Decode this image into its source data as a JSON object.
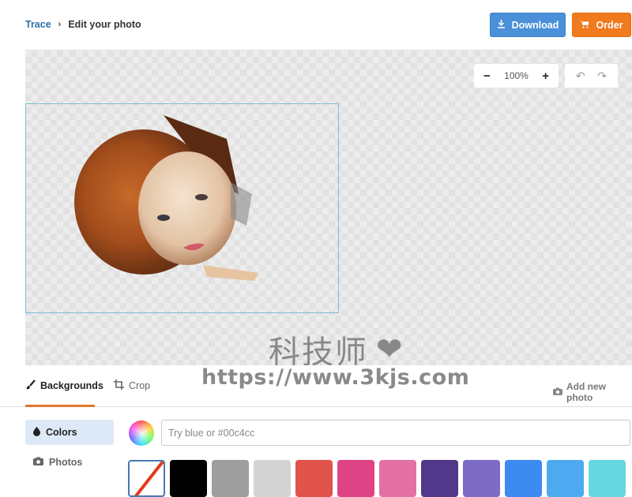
{
  "breadcrumb": {
    "root": "Trace",
    "separator": "›",
    "current": "Edit your photo"
  },
  "header": {
    "download_label": "Download",
    "order_label": "Order",
    "download_icon": "download-icon",
    "order_icon": "cart-icon",
    "colors": {
      "download": "#4a90d9",
      "order": "#f07a1e"
    }
  },
  "canvas": {
    "zoom_out": "−",
    "zoom_level": "100%",
    "zoom_in": "+",
    "undo": "↶",
    "redo": "↷",
    "photo_description": "Pixelated portrait of a person with red-brown hair"
  },
  "watermark": {
    "cn_text": "科技师",
    "heart": "❤",
    "url": "https://www.3kjs.com"
  },
  "tabs": [
    {
      "label": "Backgrounds",
      "icon": "brush-icon",
      "active": true
    },
    {
      "label": "Crop",
      "icon": "crop-icon",
      "active": false
    }
  ],
  "add_photo_label": "Add new photo",
  "sidebar": [
    {
      "label": "Colors",
      "icon": "drop-icon",
      "active": true
    },
    {
      "label": "Photos",
      "icon": "camera-icon",
      "active": false
    }
  ],
  "color_input": {
    "placeholder": "Try blue or #00c4cc",
    "value": ""
  },
  "swatches": [
    {
      "name": "none",
      "color": "transparent",
      "selected": true
    },
    {
      "name": "black",
      "color": "#000000"
    },
    {
      "name": "gray",
      "color": "#9e9e9e"
    },
    {
      "name": "light-gray",
      "color": "#d3d3d3"
    },
    {
      "name": "red",
      "color": "#e2544b"
    },
    {
      "name": "magenta",
      "color": "#de4386"
    },
    {
      "name": "pink",
      "color": "#e371a3"
    },
    {
      "name": "dark-purple",
      "color": "#51388a"
    },
    {
      "name": "lavender",
      "color": "#7d6bc6"
    },
    {
      "name": "blue",
      "color": "#3d8af0"
    },
    {
      "name": "sky-blue",
      "color": "#4eaaf0"
    },
    {
      "name": "cyan",
      "color": "#66d6e0"
    }
  ]
}
